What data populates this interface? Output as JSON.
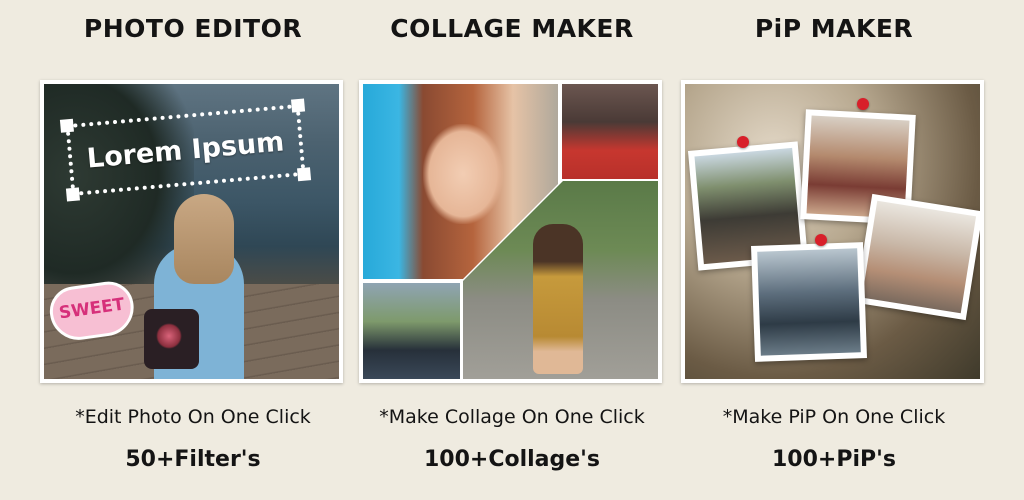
{
  "panels": [
    {
      "title": "PHOTO EDITOR",
      "feature": "*Edit Photo On One Click",
      "count": "50+Filter's",
      "overlay_text": "Lorem Ipsum",
      "sticker_text": "SWEET"
    },
    {
      "title": "COLLAGE MAKER",
      "feature": "*Make Collage On One Click",
      "count": "100+Collage's"
    },
    {
      "title": "PiP MAKER",
      "feature": "*Make PiP On One Click",
      "count": "100+PiP's"
    }
  ],
  "colors": {
    "background": "#efebe0",
    "text": "#141414",
    "pin": "#d81f2a",
    "sticker": "#d6307a"
  }
}
